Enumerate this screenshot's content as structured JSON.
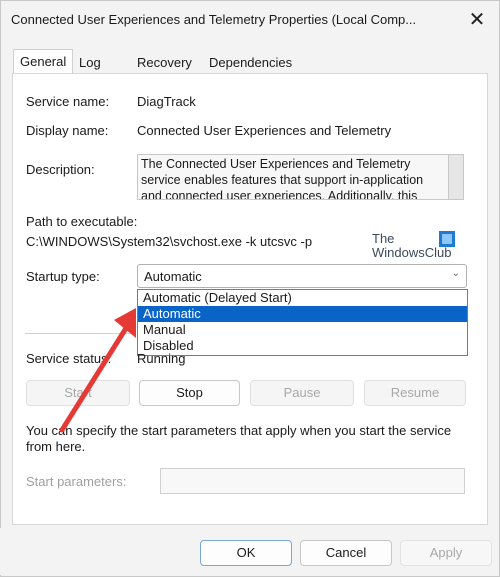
{
  "window": {
    "title": "Connected User Experiences and Telemetry Properties (Local Comp...",
    "close_glyph": "✕"
  },
  "tabs": [
    {
      "label": "General",
      "active": true
    },
    {
      "label": "Log On",
      "active": false
    },
    {
      "label": "Recovery",
      "active": false
    },
    {
      "label": "Dependencies",
      "active": false
    }
  ],
  "general": {
    "service_name_label": "Service name:",
    "service_name_value": "DiagTrack",
    "display_name_label": "Display name:",
    "display_name_value": "Connected User Experiences and Telemetry",
    "description_label": "Description:",
    "description_value": "The Connected User Experiences and Telemetry service enables features that support in-application and connected user experiences. Additionally, this",
    "path_label": "Path to executable:",
    "path_value": "C:\\WINDOWS\\System32\\svchost.exe -k utcsvc -p",
    "startup_label": "Startup type:",
    "startup_selected": "Automatic",
    "startup_options": [
      "Automatic (Delayed Start)",
      "Automatic",
      "Manual",
      "Disabled"
    ],
    "startup_highlighted": "Automatic",
    "status_label": "Service status:",
    "status_value": "Running",
    "buttons": {
      "start": "Start",
      "stop": "Stop",
      "pause": "Pause",
      "resume": "Resume"
    },
    "params_note": "You can specify the start parameters that apply when you start the service from here.",
    "start_params_label": "Start parameters:",
    "start_params_value": ""
  },
  "watermark": {
    "line1": "The",
    "line2": "WindowsClub"
  },
  "footer": {
    "ok": "OK",
    "cancel": "Cancel",
    "apply": "Apply"
  },
  "colors": {
    "highlight": "#0a64c8",
    "arrow": "#e53935",
    "watermark_accent": "#1f7ad6"
  },
  "icons": {
    "close": "close-icon",
    "dropdown": "chevron-down-icon",
    "annotation": "arrow-icon"
  }
}
